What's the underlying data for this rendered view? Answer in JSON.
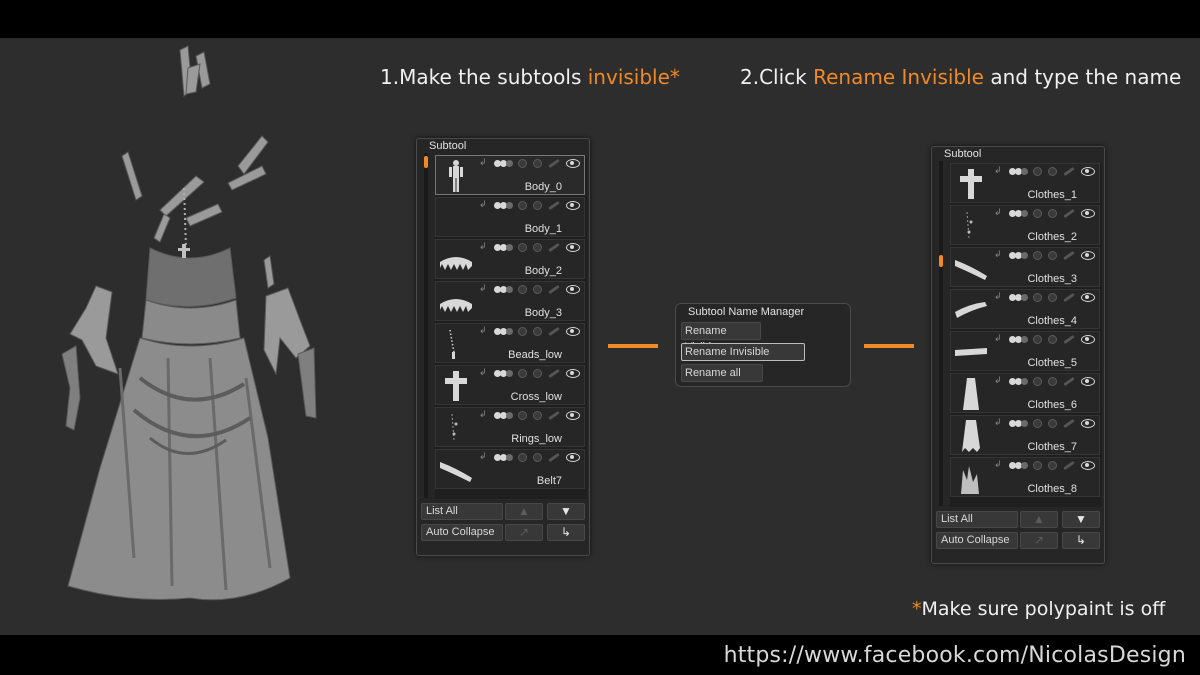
{
  "heading1": {
    "text": "1.Make the subtools ",
    "highlight": "invisible*"
  },
  "heading2": {
    "prefix": "2.Click ",
    "highlight": "Rename Invisible",
    "suffix": " and type the name"
  },
  "note": {
    "star": "*",
    "text": "Make sure polypaint is off"
  },
  "footer": {
    "url": "https://www.facebook.com/NicolasDesign"
  },
  "colors": {
    "accent": "#f08a24",
    "panel": "#262626",
    "background": "#2d2d2d"
  },
  "left_panel": {
    "header": "Subtool",
    "items": [
      {
        "name": "Body_0",
        "thumb": "body-figure",
        "active": true
      },
      {
        "name": "Body_1",
        "thumb": "none"
      },
      {
        "name": "Body_2",
        "thumb": "teeth"
      },
      {
        "name": "Body_3",
        "thumb": "teeth"
      },
      {
        "name": "Beads_low",
        "thumb": "beads"
      },
      {
        "name": "Cross_low",
        "thumb": "cross"
      },
      {
        "name": "Rings_low",
        "thumb": "rings"
      },
      {
        "name": "Belt7",
        "thumb": "belt"
      }
    ],
    "buttons": {
      "list_all": "List All",
      "auto_collapse": "Auto Collapse"
    }
  },
  "manager": {
    "title": "Subtool Name Manager",
    "rename_visible": "Rename Visible",
    "rename_invisible": "Rename Invisible",
    "rename_all": "Rename all"
  },
  "right_panel": {
    "header": "Subtool",
    "items": [
      {
        "name": "Clothes_1",
        "thumb": "cross"
      },
      {
        "name": "Clothes_2",
        "thumb": "rings"
      },
      {
        "name": "Clothes_3",
        "thumb": "belt"
      },
      {
        "name": "Clothes_4",
        "thumb": "cloth-strip"
      },
      {
        "name": "Clothes_5",
        "thumb": "cloth-flat"
      },
      {
        "name": "Clothes_6",
        "thumb": "skirt"
      },
      {
        "name": "Clothes_7",
        "thumb": "skirt-torn"
      },
      {
        "name": "Clothes_8",
        "thumb": "rags"
      }
    ],
    "buttons": {
      "list_all": "List All",
      "auto_collapse": "Auto Collapse"
    }
  }
}
